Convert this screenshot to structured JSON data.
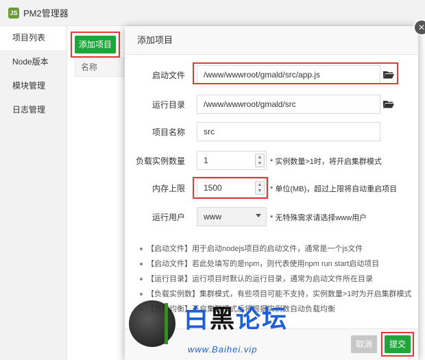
{
  "app": {
    "logo_text": "JS",
    "title": "PM2管理器"
  },
  "sidebar": {
    "items": [
      {
        "label": "项目列表",
        "active": true
      },
      {
        "label": "Node版本"
      },
      {
        "label": "模块管理"
      },
      {
        "label": "日志管理"
      }
    ]
  },
  "background": {
    "add_button_label": "添加项目",
    "table_header": "名称"
  },
  "modal": {
    "title": "添加项目",
    "close_label": "×",
    "fields": {
      "start_file": {
        "label": "启动文件",
        "value": "/www/wwwroot/gmald/src/app.js",
        "icon": "folder-icon"
      },
      "run_dir": {
        "label": "运行目录",
        "value": "/www/wwwroot/gmald/src",
        "icon": "folder-icon"
      },
      "project_name": {
        "label": "项目名称",
        "value": "src"
      },
      "instances": {
        "label": "负载实例数量",
        "value": "1",
        "hint": "* 实例数量>1时，将开启集群模式"
      },
      "memory_limit": {
        "label": "内存上限",
        "value": "1500",
        "hint": "* 单位(MB)，超过上限将自动重启项目"
      },
      "run_user": {
        "label": "运行用户",
        "value": "www",
        "hint": "* 无特殊需求请选择www用户"
      }
    },
    "notes": [
      "【启动文件】用于启动nodejs项目的启动文件，通常是一个js文件",
      "【启动文件】若此处填写的是npm，则代表使用npm run start启动项目",
      "【运行目录】运行项目时默认的运行目录，通常为启动文件所在目录",
      "【负载实例数】集群模式，有些项目可能不支持，实例数量>1时为开启集群模式",
      "【负载均衡】开启集群模式后将根据实例数自动负载均衡"
    ],
    "buttons": {
      "cancel": "取消",
      "submit": "提交"
    }
  },
  "watermark": {
    "text_1": "白",
    "text_2": "黑",
    "text_3": "论坛",
    "url": "www.Baihei.vip"
  },
  "colors": {
    "accent_green": "#20a53a",
    "highlight_red": "#e53935",
    "watermark_blue": "#1e5fd6"
  }
}
